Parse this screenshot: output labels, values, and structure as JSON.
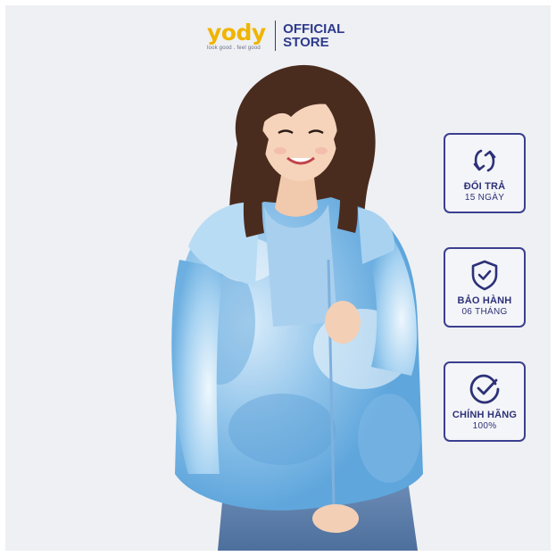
{
  "brand": {
    "logo_text": "yody",
    "tagline": "look good . feel good",
    "store_label_line1": "OFFICIAL",
    "store_label_line2": "STORE"
  },
  "badges": [
    {
      "icon": "refresh-icon",
      "title": "ĐỔI TRẢ",
      "subtitle": "15 NGÀY"
    },
    {
      "icon": "shield-check-icon",
      "title": "BẢO HÀNH",
      "subtitle": "06 THÁNG"
    },
    {
      "icon": "check-circle-icon",
      "title": "CHÍNH HÃNG",
      "subtitle": "100%"
    }
  ],
  "colors": {
    "accent": "#f0b400",
    "brand_navy": "#2d3a8c",
    "background": "#eef0f3",
    "jacket": "#9ccbed"
  }
}
